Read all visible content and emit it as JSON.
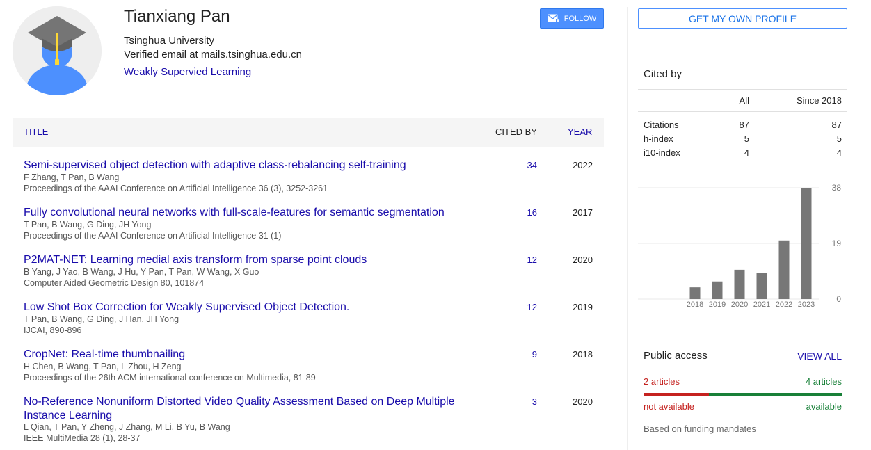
{
  "profile": {
    "name": "Tianxiang Pan",
    "affiliation": "Tsinghua University",
    "email": "Verified email at mails.tsinghua.edu.cn",
    "interest": "Weakly Supervied Learning",
    "follow_label": "FOLLOW"
  },
  "table": {
    "col_title": "TITLE",
    "col_cited": "CITED BY",
    "col_year": "YEAR"
  },
  "publications": [
    {
      "title": "Semi-supervised object detection with adaptive class-rebalancing self-training",
      "authors": "F Zhang, T Pan, B Wang",
      "venue": "Proceedings of the AAAI Conference on Artificial Intelligence 36 (3), 3252-3261",
      "cited": "34",
      "year": "2022"
    },
    {
      "title": "Fully convolutional neural networks with full-scale-features for semantic segmentation",
      "authors": "T Pan, B Wang, G Ding, JH Yong",
      "venue": "Proceedings of the AAAI Conference on Artificial Intelligence 31 (1)",
      "cited": "16",
      "year": "2017"
    },
    {
      "title": "P2MAT-NET: Learning medial axis transform from sparse point clouds",
      "authors": "B Yang, J Yao, B Wang, J Hu, Y Pan, T Pan, W Wang, X Guo",
      "venue": "Computer Aided Geometric Design 80, 101874",
      "cited": "12",
      "year": "2020"
    },
    {
      "title": "Low Shot Box Correction for Weakly Supervised Object Detection.",
      "authors": "T Pan, B Wang, G Ding, J Han, JH Yong",
      "venue": "IJCAI, 890-896",
      "cited": "12",
      "year": "2019"
    },
    {
      "title": "CropNet: Real-time thumbnailing",
      "authors": "H Chen, B Wang, T Pan, L Zhou, H Zeng",
      "venue": "Proceedings of the 26th ACM international conference on Multimedia, 81-89",
      "cited": "9",
      "year": "2018"
    },
    {
      "title": "No-Reference Nonuniform Distorted Video Quality Assessment Based on Deep Multiple Instance Learning",
      "authors": "L Qian, T Pan, Y Zheng, J Zhang, M Li, B Yu, B Wang",
      "venue": "IEEE MultiMedia 28 (1), 28-37",
      "cited": "3",
      "year": "2020"
    }
  ],
  "sidebar": {
    "get_profile_label": "GET MY OWN PROFILE",
    "cited_by_title": "Cited by",
    "header_all": "All",
    "header_since": "Since 2018",
    "stats": [
      {
        "label": "Citations",
        "all": "87",
        "since": "87"
      },
      {
        "label": "h-index",
        "all": "5",
        "since": "5"
      },
      {
        "label": "i10-index",
        "all": "4",
        "since": "4"
      }
    ],
    "public_access": {
      "title": "Public access",
      "view_all": "VIEW ALL",
      "not_available_count": "2 articles",
      "available_count": "4 articles",
      "not_available_label": "not available",
      "available_label": "available",
      "not_available_fraction": 0.33,
      "note": "Based on funding mandates"
    }
  },
  "colors": {
    "link": "#1a0dab",
    "accent": "#4d90fe",
    "bar": "#777777",
    "not_available": "#c5221f",
    "available": "#188038"
  },
  "chart_data": {
    "type": "bar",
    "categories": [
      "2018",
      "2019",
      "2020",
      "2021",
      "2022",
      "2023"
    ],
    "values": [
      4,
      6,
      10,
      9,
      20,
      38
    ],
    "yticks": [
      0,
      19,
      38
    ],
    "ylim": [
      0,
      38
    ],
    "grid": true
  }
}
